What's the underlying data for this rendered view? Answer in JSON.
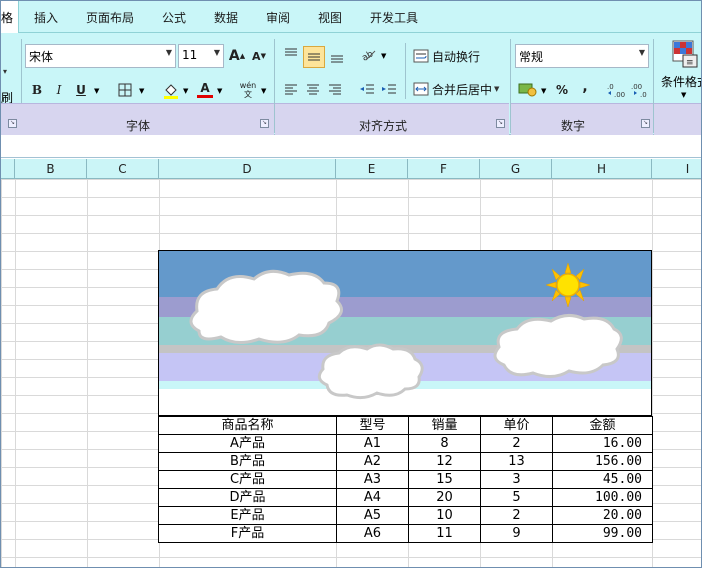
{
  "tabs": {
    "active": "格",
    "items": [
      "插入",
      "页面布局",
      "公式",
      "数据",
      "审阅",
      "视图",
      "开发工具"
    ]
  },
  "ribbon": {
    "left_cut_label": "刷",
    "font_group": {
      "label": "字体",
      "font_name": "宋体",
      "font_size": "11",
      "grow_font": "A",
      "shrink_font": "A",
      "bold": "B",
      "italic": "I",
      "underline": "U",
      "font_color_letter": "A",
      "phonetic": "wén\n文"
    },
    "align_group": {
      "label": "对齐方式",
      "wrap_text": "自动换行",
      "merge_center": "合并后居中"
    },
    "number_group": {
      "label": "数字",
      "format": "常规",
      "percent": "%",
      "comma": ","
    },
    "styles_group": {
      "conditional_format": "条件格式"
    }
  },
  "columns": [
    "B",
    "C",
    "D",
    "E",
    "F",
    "G",
    "H",
    "I"
  ],
  "table": {
    "headers": [
      "商品名称",
      "型号",
      "销量",
      "单价",
      "金额"
    ],
    "rows": [
      [
        "A产品",
        "A1",
        "8",
        "2",
        "16.00"
      ],
      [
        "B产品",
        "A2",
        "12",
        "13",
        "156.00"
      ],
      [
        "C产品",
        "A3",
        "15",
        "3",
        "45.00"
      ],
      [
        "D产品",
        "A4",
        "20",
        "5",
        "100.00"
      ],
      [
        "E产品",
        "A5",
        "10",
        "2",
        "20.00"
      ],
      [
        "F产品",
        "A6",
        "11",
        "9",
        "99.00"
      ]
    ]
  },
  "colors": {
    "ribbon_bg": "#c9f6f8",
    "group_footer": "#d7d5ef",
    "sky_top": "#6499cb",
    "sky_band_purple": "#9c9ccf",
    "sky_band_teal": "#96cfd0",
    "sky_band_lavender": "#c5c5f5",
    "sun": "#ffd700"
  }
}
